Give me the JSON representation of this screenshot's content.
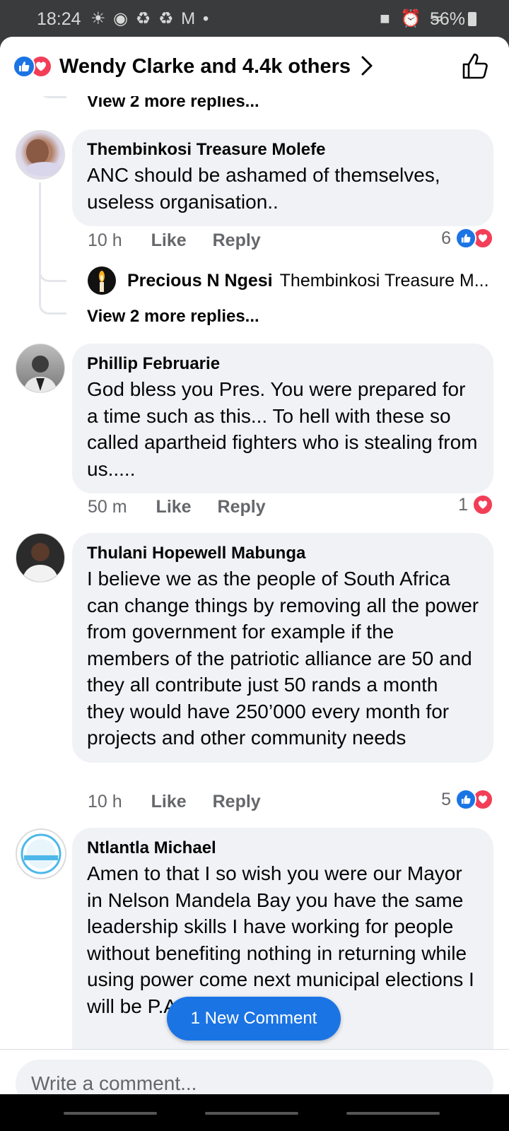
{
  "status_bar": {
    "time": "18:24",
    "battery": "56%"
  },
  "header": {
    "likers": "Wendy Clarke and 4.4k others"
  },
  "thread": {
    "view_more_top": "View 2 more replies...",
    "comments": [
      {
        "name": "Thembinkosi Treasure Molefe",
        "text": "ANC should be ashamed of themselves, useless organisation..",
        "time": "10 h",
        "like": "Like",
        "reply": "Reply",
        "reaction_count": "6"
      },
      {
        "name": "Phillip Februarie",
        "text": "God bless you Pres. You were prepared for a time such as this... To hell with these so called apartheid fighters who is stealing from us.....",
        "time": "50 m",
        "like": "Like",
        "reply": "Reply",
        "reaction_count": "1"
      },
      {
        "name": "Thulani Hopewell Mabunga",
        "text": "I believe we as the people of South Africa can change things by removing all the power from government for example if the members of the patriotic alliance are 50 and they all contribute just 50 rands a month they would have 250’000 every month for projects and other community needs",
        "time": "10 h",
        "like": "Like",
        "reply": "Reply",
        "reaction_count": "5"
      },
      {
        "name": "Ntlantla Michael",
        "text": "Amen to that I so wish you were our Mayor in Nelson Mandela Bay you have the same leadership skills I have working for people without benefiting nothing in returning while using power come next municipal elections I will be  P.A in"
      }
    ],
    "reply_preview": {
      "name": "Precious N Ngesi",
      "text": "Thembinkosi Treasure M..."
    },
    "view_more_second": "View 2 more replies..."
  },
  "new_comment_button": "1 New Comment",
  "composer": {
    "placeholder": "Write a comment..."
  }
}
